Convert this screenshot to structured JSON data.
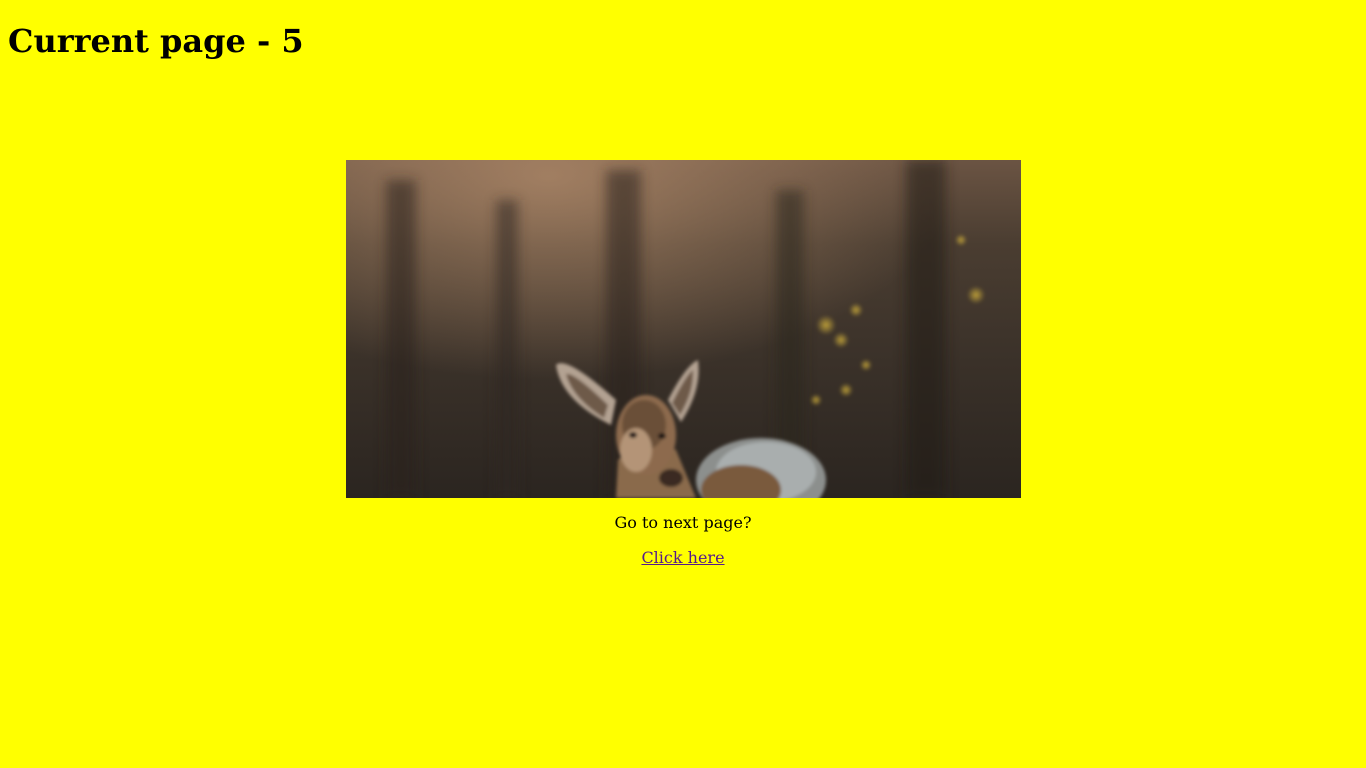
{
  "page": {
    "background_color": "#ffff00",
    "title": "Current page - 5"
  },
  "photo": {
    "subject": "deer-in-forest"
  },
  "navigation": {
    "prompt": "Go to next page?",
    "link_label": "Click here",
    "link_color": "#551a8b"
  }
}
